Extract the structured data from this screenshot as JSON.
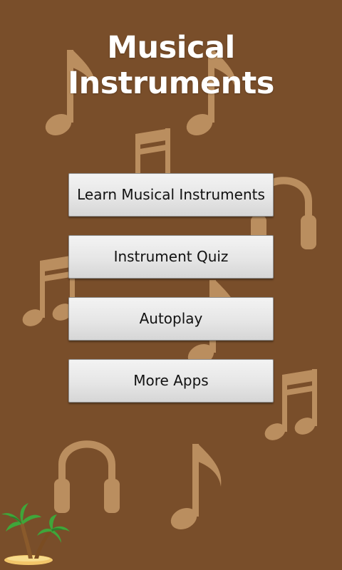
{
  "app": {
    "title": "Musical Instruments"
  },
  "menu": {
    "items": [
      {
        "id": "learn",
        "label": "Learn Musical Instruments"
      },
      {
        "id": "quiz",
        "label": "Instrument Quiz"
      },
      {
        "id": "autoplay",
        "label": "Autoplay"
      },
      {
        "id": "more",
        "label": "More Apps"
      }
    ]
  },
  "colors": {
    "background": "#794e2a",
    "decoration": "#c79a6a",
    "title": "#ffffff",
    "button_text": "#111111"
  },
  "icons": {
    "background": [
      "eighth-note-icon",
      "beamed-notes-icon",
      "headphones-icon"
    ],
    "corner": "palm-tree-icon"
  }
}
